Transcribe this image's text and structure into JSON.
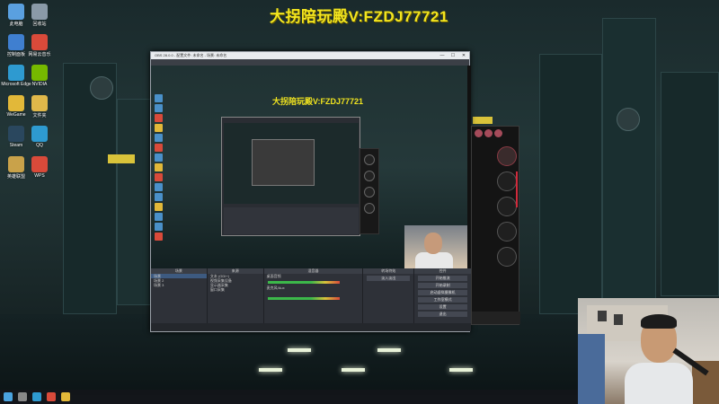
{
  "banner": {
    "text": "大拐陪玩殿V:FZDJ77721"
  },
  "desktop": {
    "icons": [
      {
        "label": "此电脑",
        "color": "#5aa0e0"
      },
      {
        "label": "回收站",
        "color": "#8a9aa8"
      },
      {
        "label": "控制面板",
        "color": "#3f7fd0"
      },
      {
        "label": "网易云音乐",
        "color": "#d94a3a"
      },
      {
        "label": "Microsoft Edge",
        "color": "#2e9ad0"
      },
      {
        "label": "NVIDIA",
        "color": "#76b900"
      },
      {
        "label": "WeGame",
        "color": "#e2b839"
      },
      {
        "label": "文件夹",
        "color": "#e0b84a"
      },
      {
        "label": "Steam",
        "color": "#2a475e"
      },
      {
        "label": "QQ",
        "color": "#2e9ad0"
      },
      {
        "label": "英雄联盟",
        "color": "#c9a24a"
      },
      {
        "label": "WPS",
        "color": "#d94a3a"
      }
    ]
  },
  "obs": {
    "window_title": "OBS 28.0.0 - 配置文件: 未命名 - 场景: 未命名",
    "preview_banner": "大拐陪玩殿V:FZDJ77721",
    "mini_banner": "大拐陪玩殿V:FZDJ77721",
    "docks": {
      "scenes": {
        "title": "场景",
        "items": [
          "场景",
          "场景 2",
          "场景 3"
        ]
      },
      "sources": {
        "title": "来源",
        "items": [
          "文本 (GDI+)",
          "视频采集设备",
          "显示器采集",
          "窗口采集"
        ]
      },
      "mixer": {
        "title": "混音器",
        "tracks": [
          "桌面音频",
          "麦克风/Aux"
        ]
      },
      "transitions": {
        "title": "转场特效",
        "value": "淡入淡出"
      },
      "controls": {
        "title": "控件",
        "buttons": [
          "开始推流",
          "开始录制",
          "启动虚拟摄像机",
          "工作室模式",
          "设置",
          "退出"
        ]
      }
    },
    "window_controls": [
      "—",
      "☐",
      "✕"
    ]
  },
  "taskbar": {
    "items": [
      "start-icon",
      "search-icon",
      "edge-icon",
      "obs-icon",
      "game-icon"
    ]
  }
}
